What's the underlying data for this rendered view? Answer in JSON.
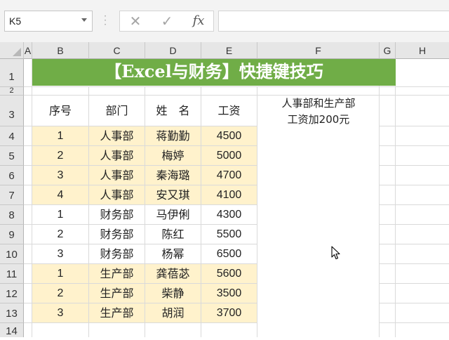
{
  "formula_bar": {
    "name_box": "K5",
    "cancel_icon": "✕",
    "enter_icon": "✓",
    "fx_label": "fx",
    "formula": ""
  },
  "columns": [
    "A",
    "B",
    "C",
    "D",
    "E",
    "F",
    "G",
    "H"
  ],
  "rows": [
    "1",
    "2",
    "3",
    "4",
    "5",
    "6",
    "7",
    "8",
    "9",
    "10",
    "11",
    "12",
    "13",
    "14"
  ],
  "title": "【Excel与财务】快捷键技巧",
  "headers": {
    "seq": "序号",
    "dept": "部门",
    "name": "姓　名",
    "salary": "工资"
  },
  "note": {
    "line1": "人事部和生产部",
    "line2": "工资加200元"
  },
  "records": [
    {
      "seq": "1",
      "dept": "人事部",
      "name": "蒋勤勤",
      "salary": "4500"
    },
    {
      "seq": "2",
      "dept": "人事部",
      "name": "梅婷",
      "salary": "5000"
    },
    {
      "seq": "3",
      "dept": "人事部",
      "name": "秦海璐",
      "salary": "4700"
    },
    {
      "seq": "4",
      "dept": "人事部",
      "name": "安又琪",
      "salary": "4100"
    },
    {
      "seq": "1",
      "dept": "财务部",
      "name": "马伊俐",
      "salary": "4300"
    },
    {
      "seq": "2",
      "dept": "财务部",
      "name": "陈红",
      "salary": "5500"
    },
    {
      "seq": "3",
      "dept": "财务部",
      "name": "杨幂",
      "salary": "6500"
    },
    {
      "seq": "1",
      "dept": "生产部",
      "name": "龚蓓苾",
      "salary": "5600"
    },
    {
      "seq": "2",
      "dept": "生产部",
      "name": "柴静",
      "salary": "3500"
    },
    {
      "seq": "3",
      "dept": "生产部",
      "name": "胡润",
      "salary": "3700"
    }
  ],
  "colors": {
    "title_fill": "#70ad47",
    "highlight_fill": "#fff2cc",
    "header_fill": "#e6e6e6"
  }
}
